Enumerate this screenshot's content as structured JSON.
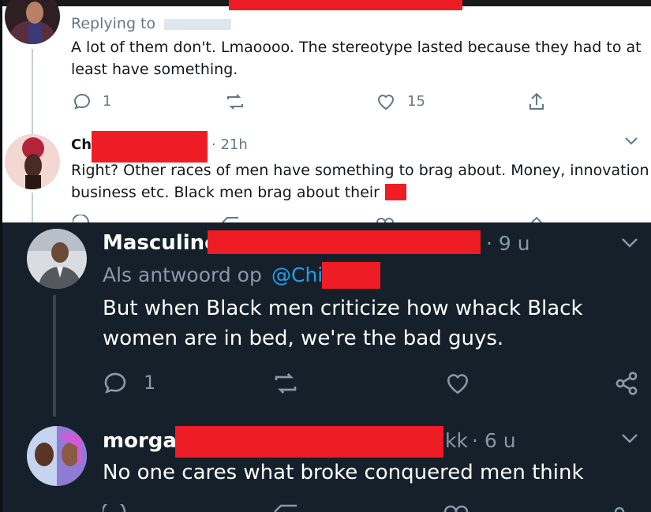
{
  "tweet1": {
    "replying_prefix": "Replying to",
    "text_line1": "A lot of them don't. Lmaoooo. The stereotype lasted because they had to at",
    "text_line2": "least have something.",
    "reply_count": "1",
    "like_count": "15"
  },
  "tweet2": {
    "author_name": "Chi",
    "time": "· 21h",
    "text_line1": "Right? Other races of men have something to brag about. Money, innovation",
    "text_line2": "business etc. Black men brag about their d"
  },
  "tweet3": {
    "author_name": "Masculine",
    "time": "· 9 u",
    "replying_prefix": "Als antwoord op",
    "replying_handle": "@Chi",
    "text_line1": "But when Black men criticize how whack Black",
    "text_line2": "women are in bed, we're the bad guys.",
    "reply_count": "1"
  },
  "tweet4": {
    "author_name": "morgan",
    "handle_suffix": "kk",
    "time": "· 6 u",
    "text": "No one cares what broke conquered men think"
  },
  "colors": {
    "light_bg": "#ffffff",
    "dark_bg": "#15202b",
    "redaction": "#ee1c25",
    "link_blue": "#1da1f2",
    "light_secondary": "#657786",
    "dark_secondary": "#8899a6"
  }
}
